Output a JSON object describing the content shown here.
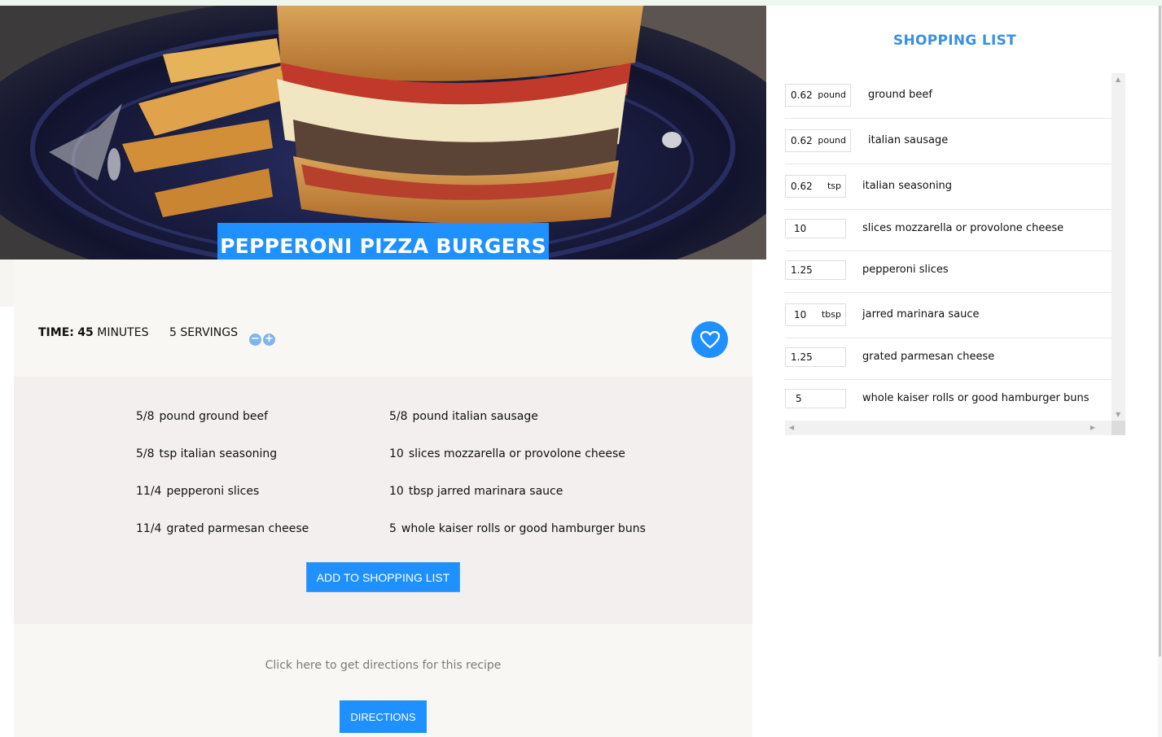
{
  "recipe": {
    "title": "PEPPERONI PIZZA BURGERS",
    "time_label": "TIME:",
    "time_value": "45",
    "time_unit": "MINUTES",
    "servings_value": "5",
    "servings_label": "SERVINGS",
    "minus_glyph": "−",
    "plus_glyph": "+",
    "ingredients": [
      {
        "qty": "5/8",
        "text": "pound ground beef"
      },
      {
        "qty": "5/8",
        "text": "pound italian sausage"
      },
      {
        "qty": "5/8",
        "text": "tsp italian seasoning"
      },
      {
        "qty": "10",
        "text": "slices mozzarella or provolone cheese"
      },
      {
        "qty": "11/4",
        "text": "pepperoni slices"
      },
      {
        "qty": "10",
        "text": "tbsp jarred marinara sauce"
      },
      {
        "qty": "11/4",
        "text": "grated parmesan cheese"
      },
      {
        "qty": "5",
        "text": "whole kaiser rolls or good hamburger buns"
      }
    ],
    "add_button": "ADD TO SHOPPING LIST",
    "directions_prompt": "Click here to get directions for this recipe",
    "directions_button": "DIRECTIONS"
  },
  "shopping_list": {
    "title": "SHOPPING LIST",
    "items": [
      {
        "qty": "0.62",
        "unit": "pound",
        "name": "ground beef"
      },
      {
        "qty": "0.62",
        "unit": "pound",
        "name": "italian sausage"
      },
      {
        "qty": "0.62",
        "unit": "tsp",
        "name": "italian seasoning"
      },
      {
        "qty": "10",
        "unit": "",
        "name": "slices mozzarella or provolone cheese"
      },
      {
        "qty": "1.25",
        "unit": "",
        "name": "pepperoni slices"
      },
      {
        "qty": "10",
        "unit": "tbsp",
        "name": "jarred marinara sauce"
      },
      {
        "qty": "1.25",
        "unit": "",
        "name": "grated parmesan cheese"
      },
      {
        "qty": "5",
        "unit": "",
        "name": "whole kaiser rolls or good hamburger buns"
      }
    ]
  },
  "icons": {
    "heart": "heart-icon",
    "minus": "minus-icon",
    "plus": "plus-icon"
  },
  "colors": {
    "accent": "#1e90ff",
    "title_blue": "#3a8fe0"
  }
}
